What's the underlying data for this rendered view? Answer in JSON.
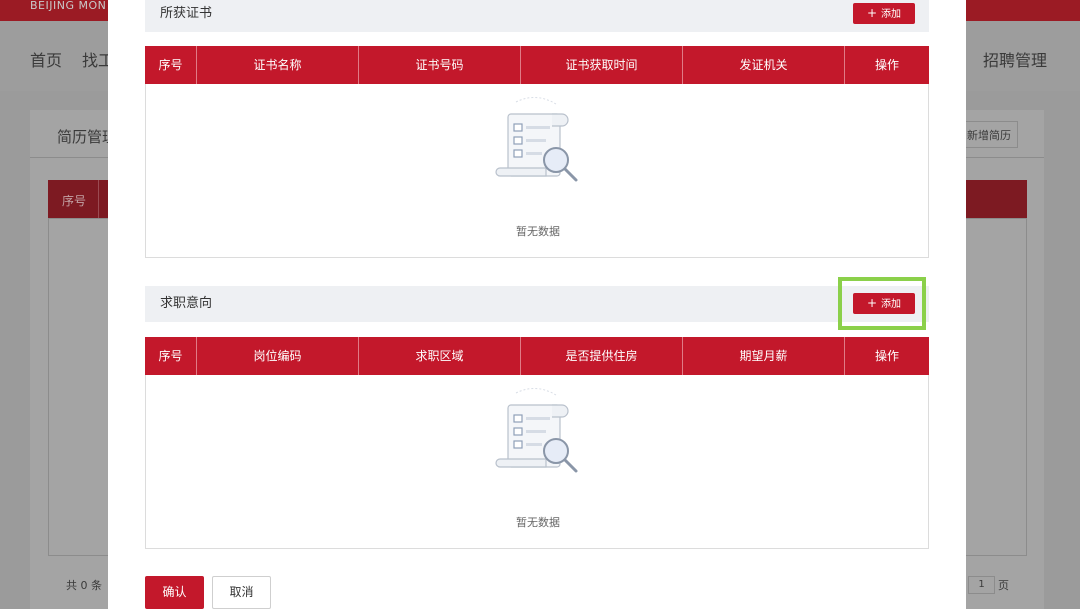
{
  "background": {
    "brand": "BEIJING MON",
    "nav": [
      "首页",
      "找工",
      "招聘管理"
    ],
    "panel_title": "简历管理",
    "new_resume_button": "新增简历",
    "table_col_seq": "序号",
    "total": "共 0 条",
    "pager_value": "1",
    "pager_unit": "页"
  },
  "modal": {
    "certificates": {
      "title": "所获证书",
      "add_label": "添加",
      "columns": [
        "序号",
        "证书名称",
        "证书号码",
        "证书获取时间",
        "发证机关",
        "操作"
      ],
      "empty_text": "暂无数据"
    },
    "job_intention": {
      "title": "求职意向",
      "add_label": "添加",
      "columns": [
        "序号",
        "岗位编码",
        "求职区域",
        "是否提供住房",
        "期望月薪",
        "操作"
      ],
      "empty_text": "暂无数据"
    },
    "confirm_label": "确认",
    "cancel_label": "取消"
  },
  "colors": {
    "primary_red": "#c3182b",
    "highlight_green": "#8bd04a",
    "section_bg": "#eef0f3"
  },
  "icons": {
    "plus": "plus-icon",
    "empty": "empty-document-search-icon"
  }
}
